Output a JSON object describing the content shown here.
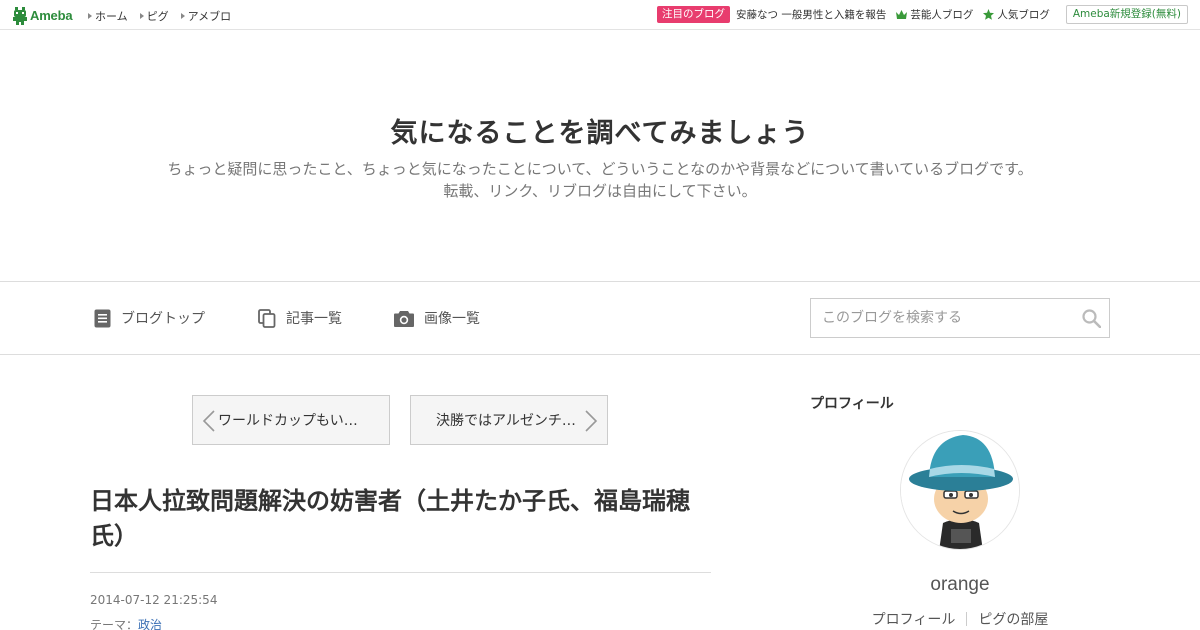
{
  "topbar": {
    "logo_text": "Ameba",
    "nav": [
      {
        "label": "ホーム"
      },
      {
        "label": "ピグ"
      },
      {
        "label": "アメブロ"
      }
    ],
    "featured_badge": "注目のブログ",
    "featured_text": "安藤なつ 一般男性と入籍を報告",
    "celebrity_blog": "芸能人ブログ",
    "popular_blog": "人気ブログ",
    "signup_label": "Ameba新規登録(無料)",
    "accent_green": "#2d8c3c",
    "badge_pink": "#e83c6e"
  },
  "header": {
    "title": "気になることを調べてみましょう",
    "desc_line1": "ちょっと疑問に思ったこと、ちょっと気になったことについて、どういうことなのかや背景などについて書いているブログです。",
    "desc_line2": "転載、リンク、リブログは自由にして下さい。"
  },
  "menu": {
    "blog_top": "ブログトップ",
    "entry_list": "記事一覧",
    "image_list": "画像一覧",
    "search_placeholder": "このブログを検索する"
  },
  "pager": {
    "prev_label": "ワールドカップもい…",
    "next_label": "決勝ではアルゼンチ…"
  },
  "entry": {
    "title": "日本人拉致問題解決の妨害者（土井たか子氏、福島瑞穂氏）",
    "date": "2014-07-12 21:25:54",
    "theme_label": "テーマ：",
    "theme_value": "政治"
  },
  "sidebar": {
    "heading": "プロフィール",
    "name": "orange",
    "profile_link": "プロフィール",
    "pig_room_link": "ピグの部屋"
  },
  "icons": {
    "logo": "ameba-logo-icon",
    "nav_arrow": "triangle-right-icon",
    "crown": "crown-icon",
    "star": "star-icon",
    "document": "document-icon",
    "copy": "copy-icon",
    "camera": "camera-icon",
    "search": "search-icon",
    "chevron_left": "chevron-left-icon",
    "chevron_right": "chevron-right-icon"
  }
}
